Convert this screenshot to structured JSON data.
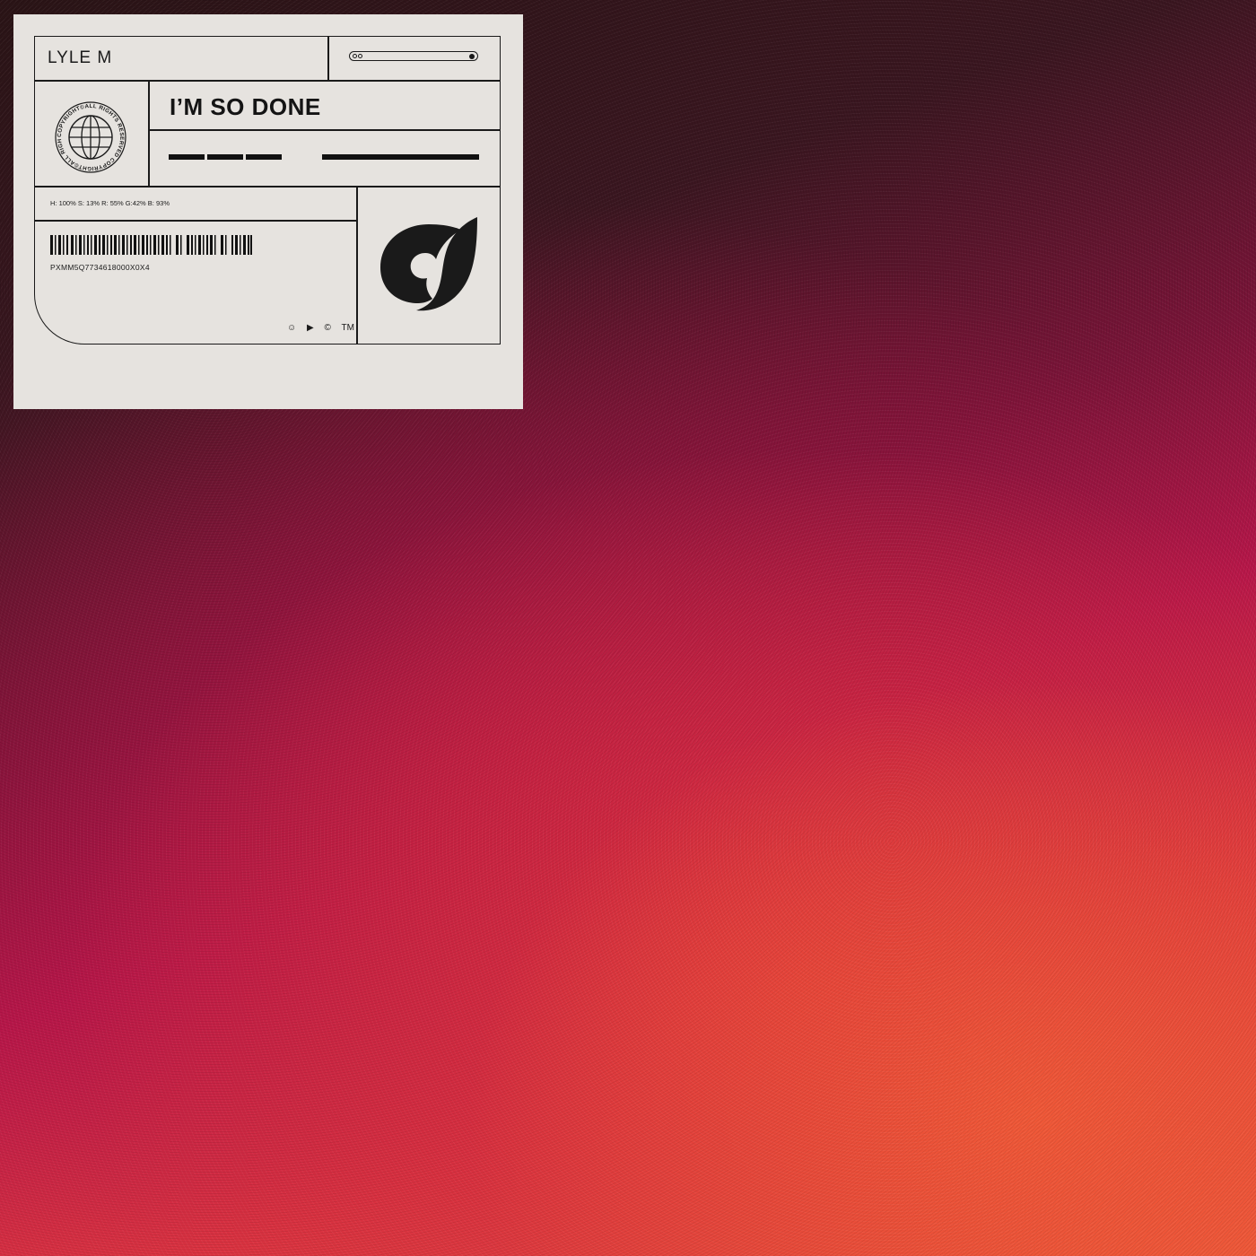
{
  "background": {
    "colors": [
      "#2a1416",
      "#7a1438",
      "#b8174a",
      "#e0383f",
      "#f0603a"
    ]
  },
  "label": {
    "card_color": "#e6e3df",
    "artist": "LYLE M",
    "title": "I’M SO DONE",
    "seal_text": "COPYRIGHT©ALL RIGHTS RESERVED COPYRIGHT©ALL RIGHTS RESERVED",
    "color_spec": "H: 100% S: 13% R: 55% G:42% B: 93%",
    "catalog_code": "PXMM5Q7734618000X0X4",
    "symbols": [
      "☺",
      "▶",
      "©",
      "TM"
    ],
    "icons": {
      "seal": "globe-seal-icon",
      "progress": "progress-bar-icon",
      "barcode": "barcode-icon",
      "logo": "label-logo-icon"
    }
  }
}
